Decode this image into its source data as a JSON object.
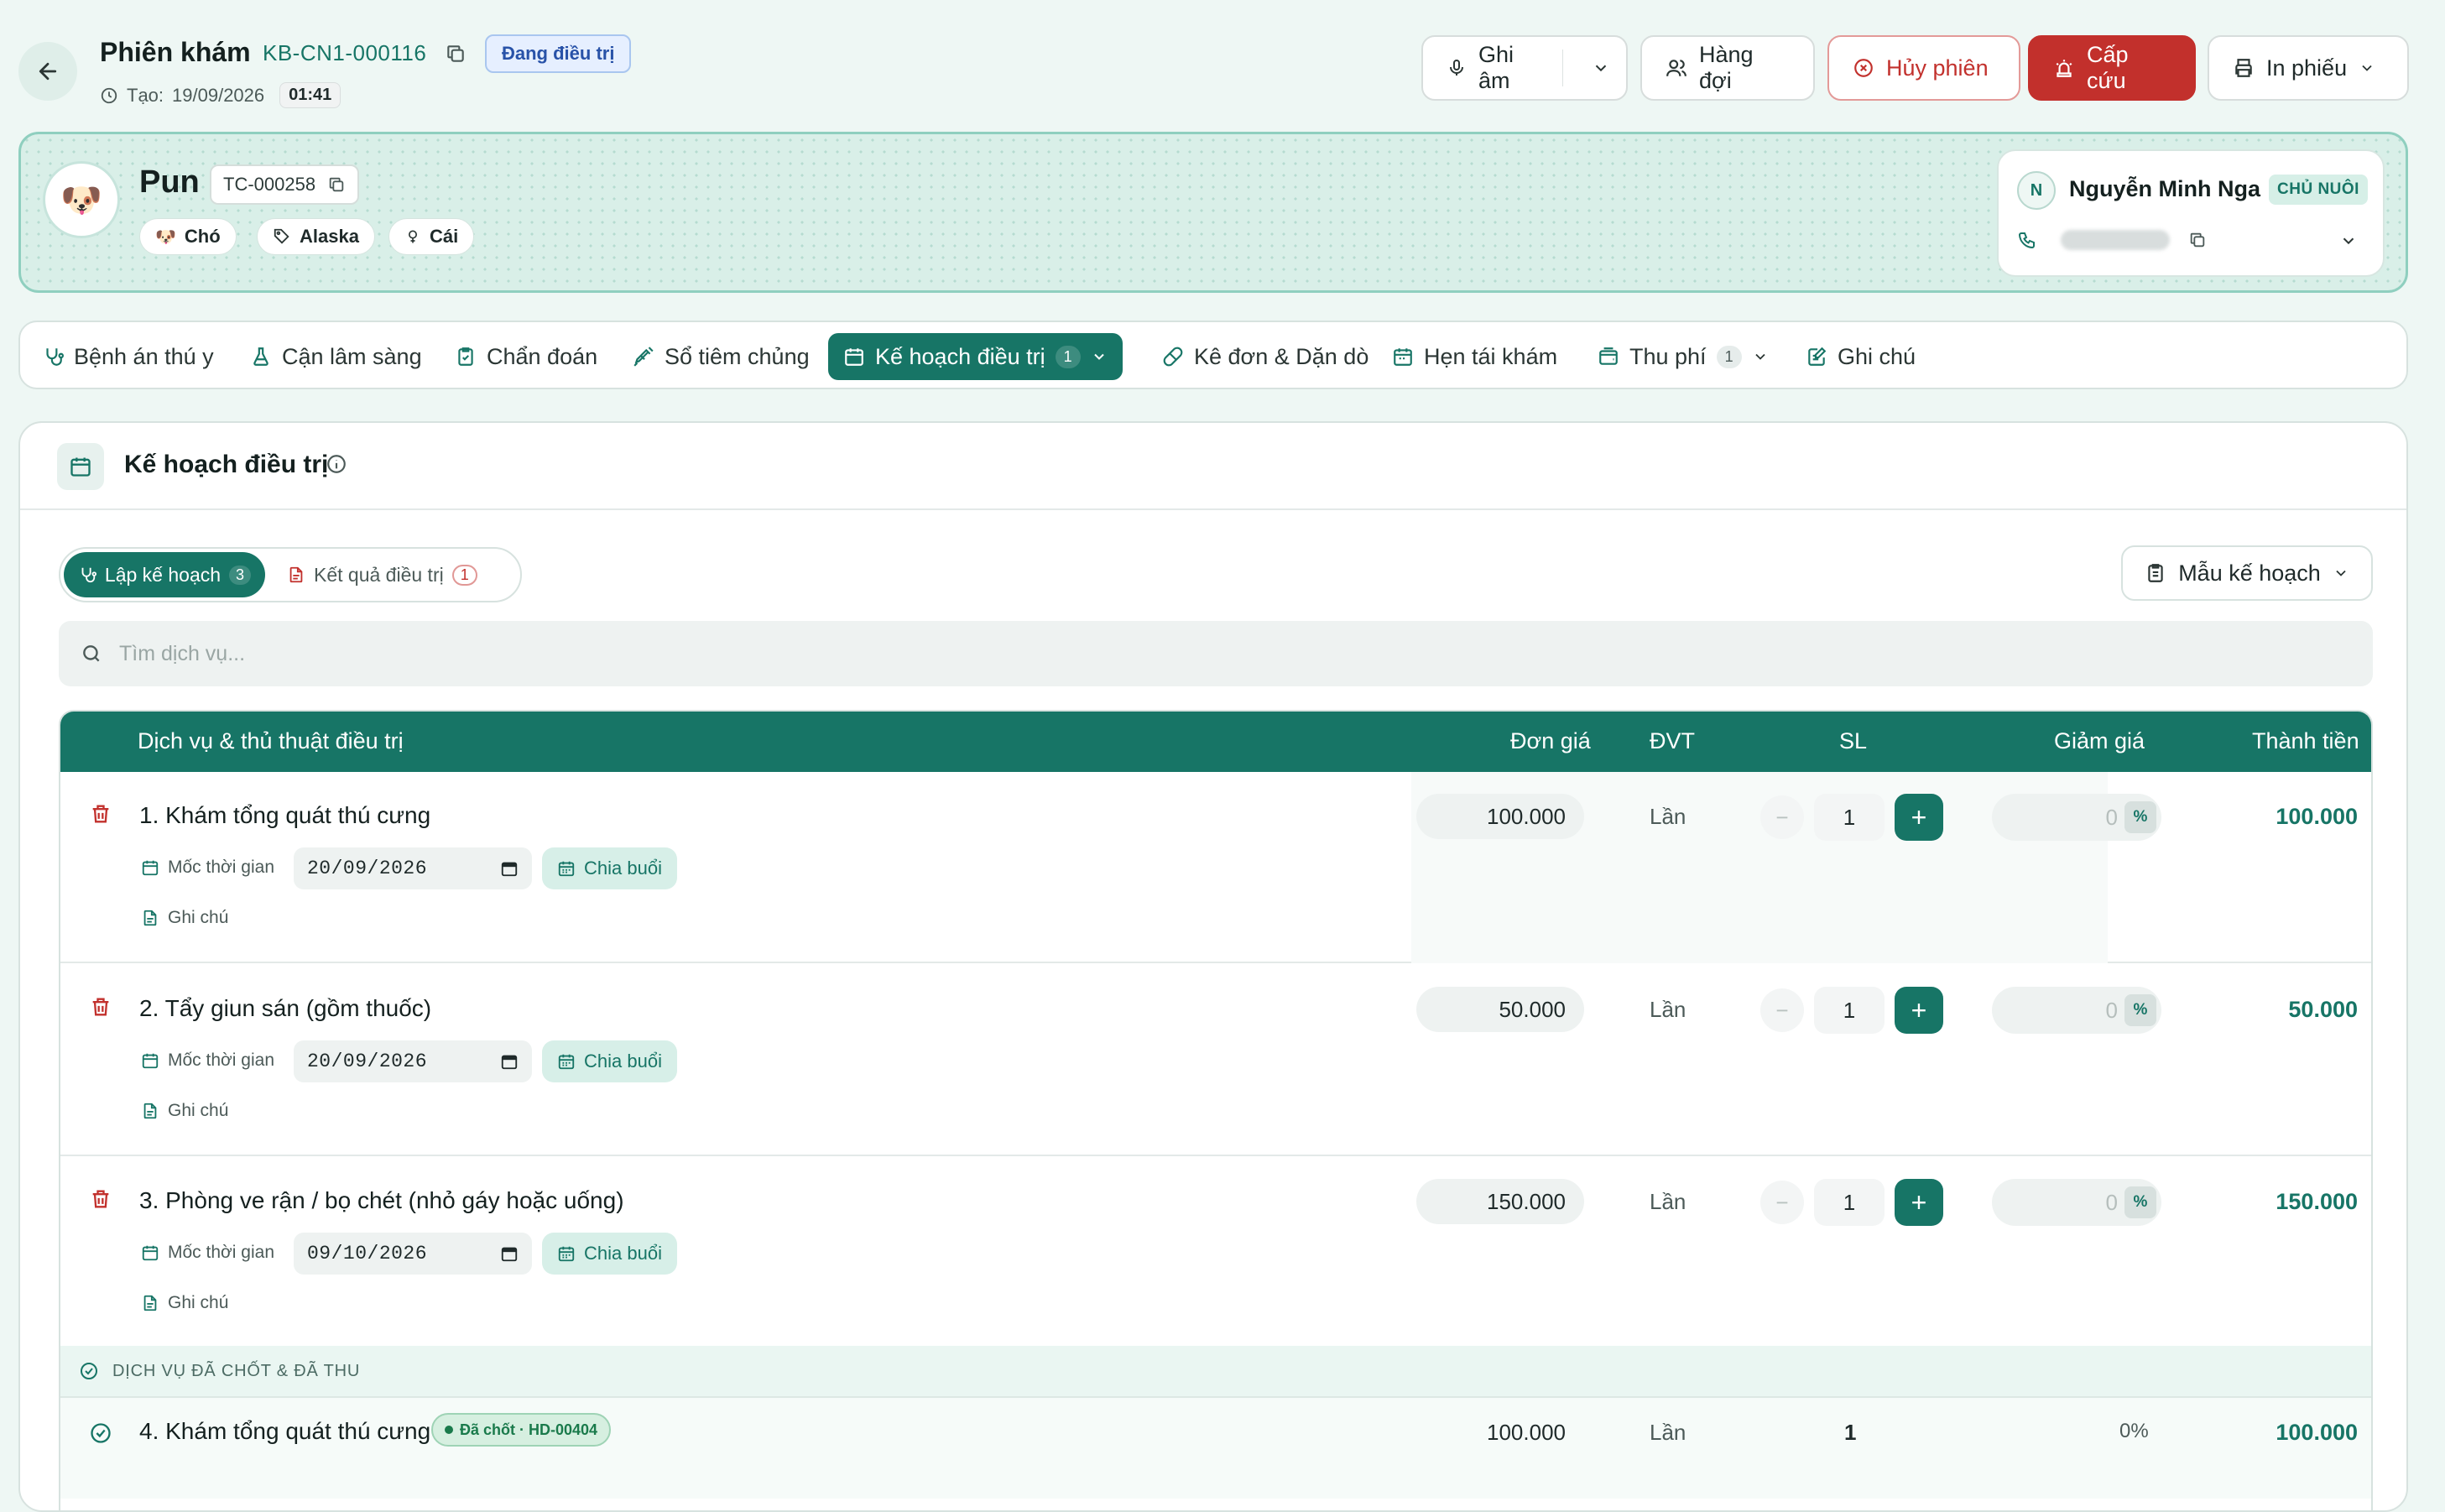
{
  "header": {
    "title": "Phiên khám",
    "code": "KB-CN1-000116",
    "status": "Đang điều trị",
    "created_label": "Tạo:",
    "created_date": "19/09/2026",
    "created_time": "01:41",
    "buttons": {
      "record": "Ghi âm",
      "queue": "Hàng đợi",
      "cancel": "Hủy phiên",
      "emergency": "Cấp cứu",
      "print": "In phiếu"
    }
  },
  "patient": {
    "name": "Pun",
    "code": "TC-000258",
    "tags": [
      "Chó",
      "Alaska",
      "Cái"
    ],
    "owner": {
      "initial": "N",
      "name": "Nguyễn Minh Nga",
      "role": "CHỦ NUÔI"
    }
  },
  "tabs": [
    {
      "label": "Bệnh án thú y"
    },
    {
      "label": "Cận lâm sàng"
    },
    {
      "label": "Chẩn đoán"
    },
    {
      "label": "Sổ tiêm chủng"
    },
    {
      "label": "Kế hoạch điều trị",
      "count": "1"
    },
    {
      "label": "Kê đơn & Dặn dò"
    },
    {
      "label": "Hẹn tái khám"
    },
    {
      "label": "Thu phí",
      "count": "1"
    },
    {
      "label": "Ghi chú"
    }
  ],
  "panel": {
    "title": "Kế hoạch điều trị",
    "seg_plan": "Lập kế hoạch",
    "seg_plan_count": "3",
    "seg_result": "Kết quả điều trị",
    "seg_result_count": "1",
    "template_btn": "Mẫu kế hoạch",
    "search_placeholder": "Tìm dịch vụ..."
  },
  "table": {
    "headers": {
      "service": "Dịch vụ & thủ thuật điều trị",
      "price": "Đơn giá",
      "unit": "ĐVT",
      "qty": "SL",
      "discount": "Giảm giá",
      "total": "Thành tiền"
    },
    "milestone_label": "Mốc thời gian",
    "split_label": "Chia buổi",
    "note_label": "Ghi chú",
    "percent": "%",
    "rows": [
      {
        "name": "1. Khám tổng quát thú cưng",
        "date": "20/09/2026",
        "price": "100.000",
        "unit": "Lần",
        "qty": "1",
        "discount": "0",
        "total": "100.000"
      },
      {
        "name": "2. Tẩy giun sán (gồm thuốc)",
        "date": "20/09/2026",
        "price": "50.000",
        "unit": "Lần",
        "qty": "1",
        "discount": "0",
        "total": "50.000"
      },
      {
        "name": "3. Phòng ve rận / bọ chét (nhỏ gáy hoặc uống)",
        "date": "09/10/2026",
        "price": "150.000",
        "unit": "Lần",
        "qty": "1",
        "discount": "0",
        "total": "150.000"
      }
    ],
    "done_section_label": "DỊCH VỤ ĐÃ CHỐT & ĐÃ THU",
    "done_rows": [
      {
        "name": "4. Khám tổng quát thú cưng",
        "badge": "Đã chốt · HD-00404",
        "price": "100.000",
        "unit": "Lần",
        "qty": "1",
        "discount": "0%",
        "total": "100.000"
      }
    ]
  },
  "colors": {
    "primary": "#177566",
    "danger": "#c2302c",
    "page_bg": "#eef7f4"
  }
}
